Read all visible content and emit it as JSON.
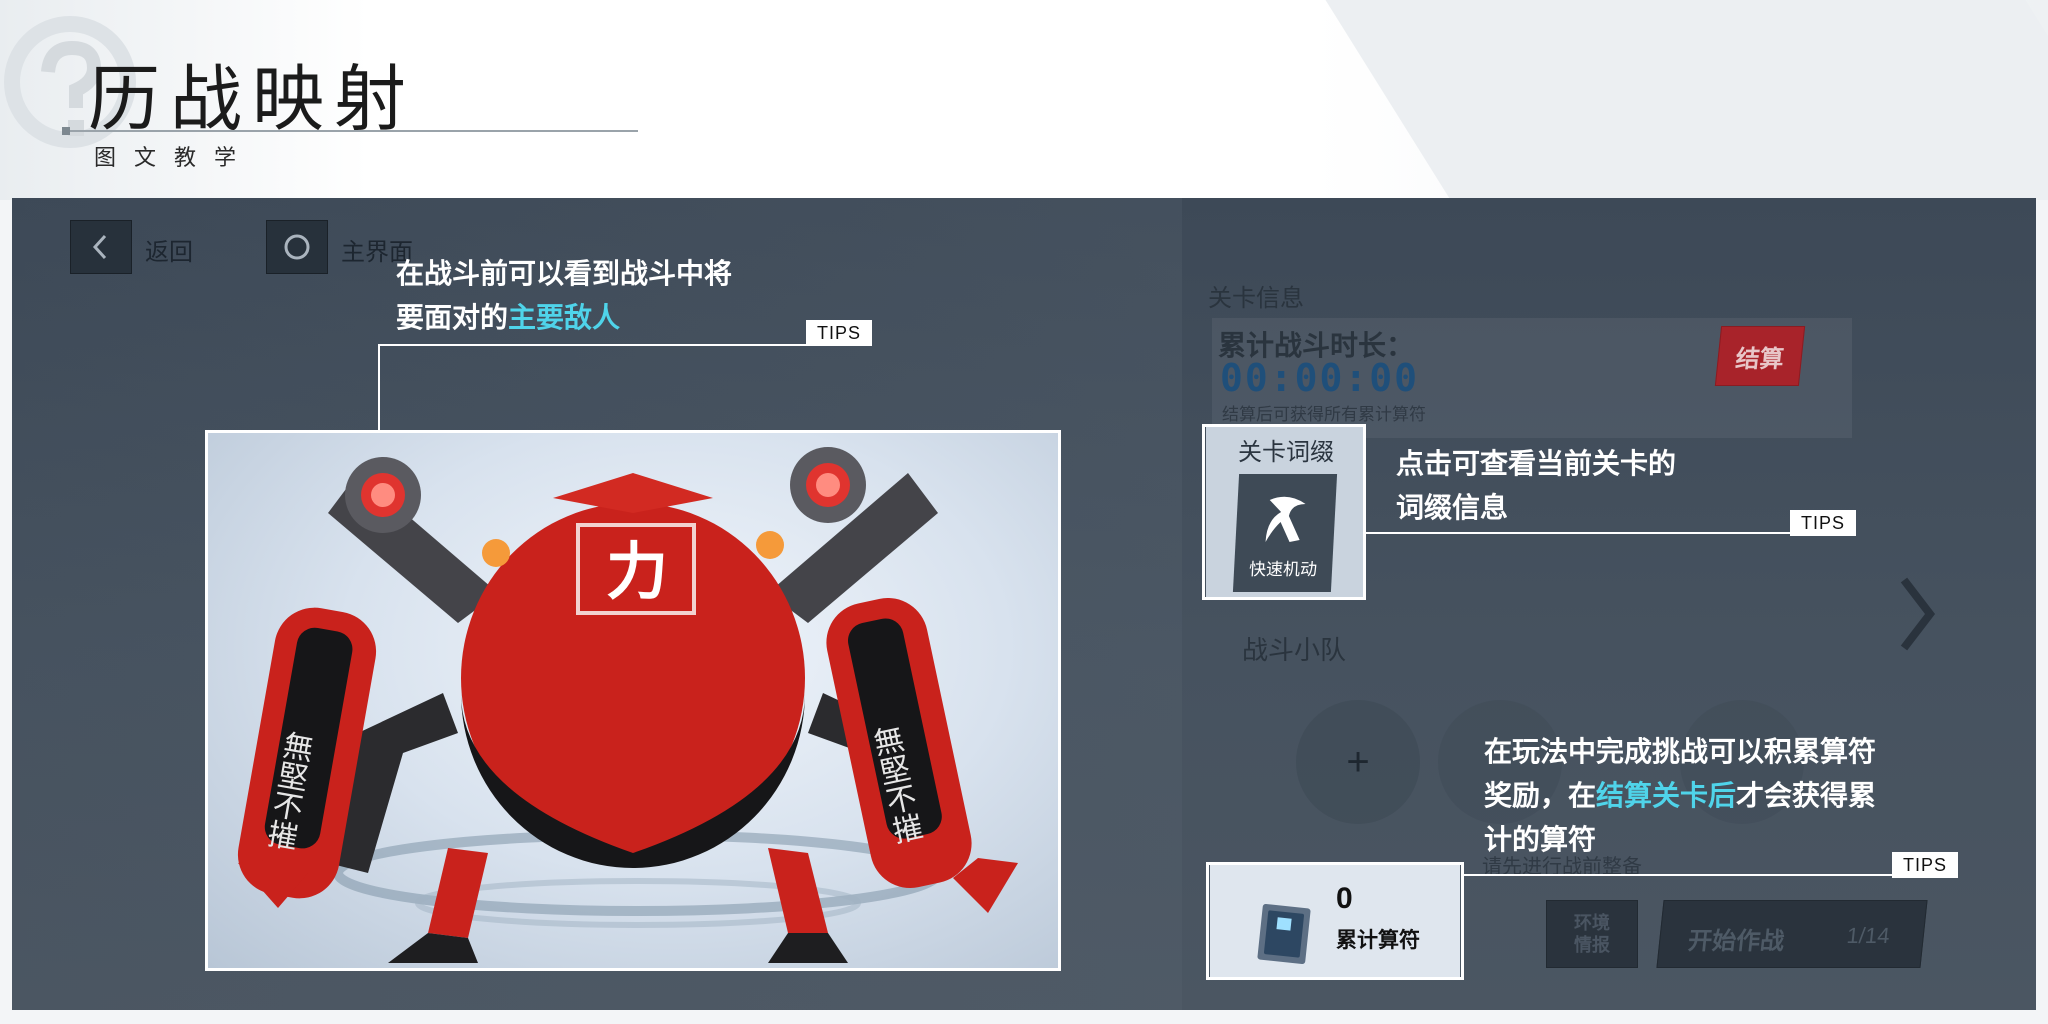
{
  "header": {
    "title": "历战映射",
    "subtitle": "图文教学"
  },
  "nav": {
    "back_label": "返回",
    "home_label": "主界面"
  },
  "level_info": {
    "section_title": "关卡信息",
    "duration_label": "累计战斗时长：",
    "duration_value": "00:00:00",
    "duration_note": "结算后可获得所有累计算符",
    "settle_button": "结算",
    "team_title": "战斗小队",
    "add_symbol": "+",
    "bottom_note": "请先进行战前整备",
    "env_button": "环境情报",
    "start_button": "开始作战",
    "page_indicator": "1/14"
  },
  "affix": {
    "title": "关卡词缀",
    "card_label": "快速机动"
  },
  "reward": {
    "count": "0",
    "label": "累计算符"
  },
  "enemy_callout": {
    "line1": "在战斗前可以看到战斗中将",
    "line2_prefix": "要面对的",
    "line2_highlight": "主要敌人",
    "tips": "TIPS"
  },
  "affix_callout": {
    "line1": "点击可查看当前关卡的",
    "line2": "词缀信息",
    "tips": "TIPS"
  },
  "reward_callout": {
    "line1": "在玩法中完成挑战可以积累算符",
    "line2_prefix": "奖励，在",
    "line2_highlight": "结算关卡后",
    "line2_suffix": "才会获得累",
    "line3": "计的算符",
    "tips": "TIPS"
  },
  "robot": {
    "body_glyph": "力",
    "arm_text": "無堅不摧"
  },
  "colors": {
    "highlight": "#4fd4ea",
    "settle_red": "#a8232a",
    "duration_blue": "#1f4f7a",
    "robot_red": "#c9221c"
  }
}
